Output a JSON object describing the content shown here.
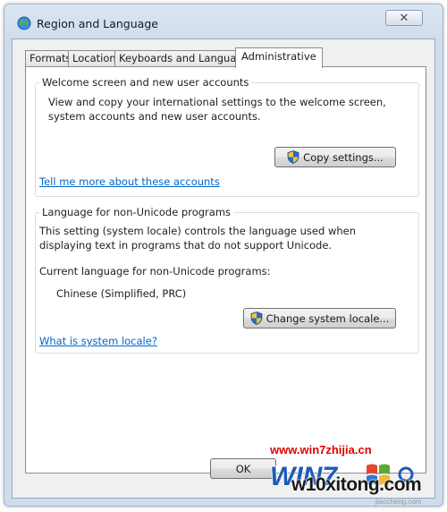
{
  "window": {
    "title": "Region and Language",
    "close_glyph": "✕"
  },
  "tabs": [
    {
      "label": "Formats",
      "active": false
    },
    {
      "label": "Location",
      "active": false
    },
    {
      "label": "Keyboards and Languages",
      "active": false
    },
    {
      "label": "Administrative",
      "active": true
    }
  ],
  "welcome_group": {
    "legend": "Welcome screen and new user accounts",
    "description": "View and copy your international settings to the welcome screen, system accounts and new user accounts.",
    "copy_button": "Copy settings...",
    "link": "Tell me more about these accounts"
  },
  "unicode_group": {
    "legend": "Language for non-Unicode programs",
    "description": "This setting (system locale) controls the language used when displaying text in programs that do not support Unicode.",
    "current_label": "Current language for non-Unicode programs:",
    "current_value": "Chinese (Simplified, PRC)",
    "change_button": "Change system locale...",
    "link": "What is system locale?"
  },
  "footer": {
    "ok_button": "OK"
  },
  "watermark": {
    "url": "www.win7zhijia.cn",
    "logo_text": "WIN7",
    "sub_text": "w10xitong.com",
    "tiny_text": "jiaocheng.com"
  },
  "icons": {
    "title": "globe-icon",
    "shield": "uac-shield-icon"
  }
}
